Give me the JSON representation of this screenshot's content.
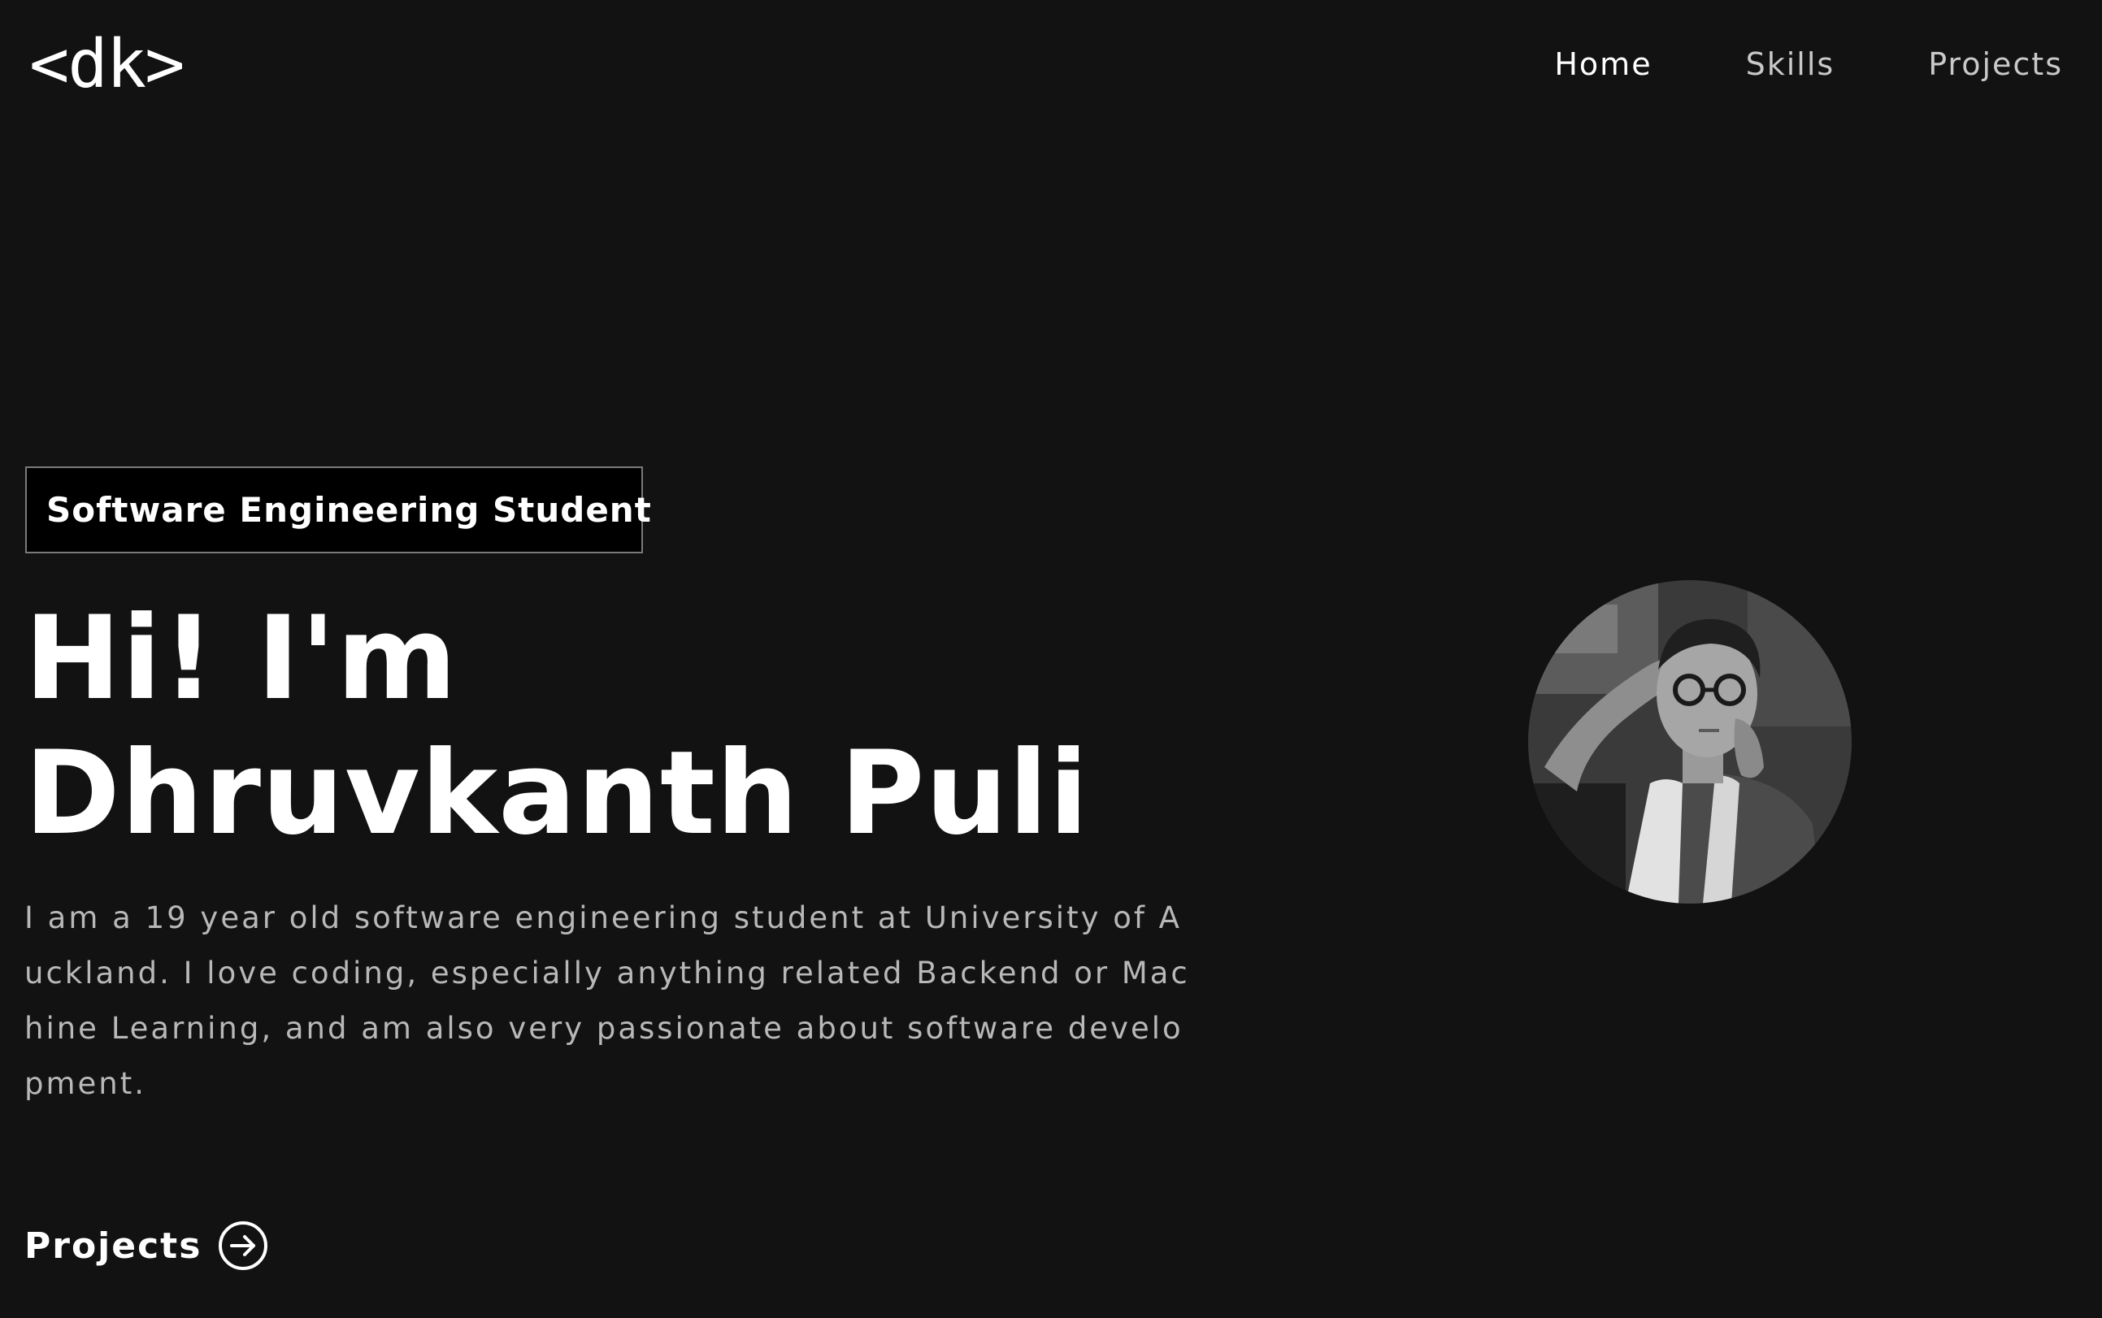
{
  "header": {
    "logo": "<dk>",
    "nav": [
      {
        "label": "Home",
        "active": true
      },
      {
        "label": "Skills",
        "active": false
      },
      {
        "label": "Projects",
        "active": false
      }
    ]
  },
  "hero": {
    "role": "Software Engineering Student",
    "title": "Hi! I'm Dhruvkanth Puli",
    "bio": "I am a 19 year old software engineering student at University of Auckland. I love coding, especially anything related Backend or Machine Learning, and am also very passionate about software development.",
    "cta_label": "Projects",
    "cta_icon": "arrow-right-circle-icon",
    "avatar_label": "profile-photo"
  },
  "colors": {
    "background": "#121212",
    "text": "#ffffff",
    "muted_text": "#b8b8b8",
    "role_box_bg": "#000000",
    "role_box_border": "#7a7a7a"
  }
}
